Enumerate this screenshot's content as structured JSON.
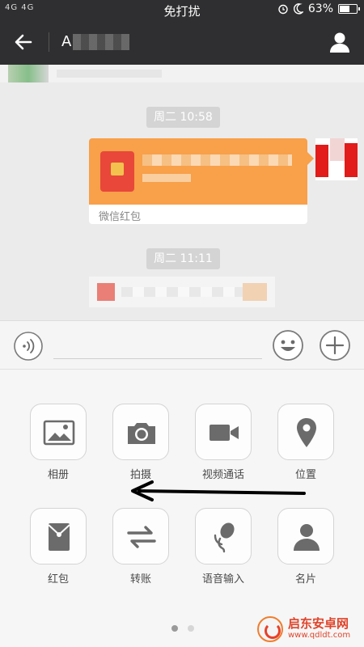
{
  "status_bar": {
    "signal_text": "4G 4G",
    "mode_text": "免打扰",
    "battery_text": "63%",
    "battery_level": 0.63
  },
  "header": {
    "contact_name_visible": "A",
    "back_icon": "arrow-left-icon",
    "profile_icon": "person-icon"
  },
  "chat": {
    "messages": [
      {
        "time": "周二 10:58",
        "type": "red-packet",
        "label": "微信红包"
      },
      {
        "time": "周二 11:11",
        "type": "text"
      }
    ]
  },
  "input_bar": {
    "voice_icon": "voice-icon",
    "emoji_icon": "emoji-icon",
    "plus_icon": "plus-icon"
  },
  "panel": {
    "items": [
      {
        "label": "相册",
        "icon": "image-icon"
      },
      {
        "label": "拍摄",
        "icon": "camera-icon"
      },
      {
        "label": "视频通话",
        "icon": "video-icon"
      },
      {
        "label": "位置",
        "icon": "location-icon"
      },
      {
        "label": "红包",
        "icon": "red-packet-icon"
      },
      {
        "label": "转账",
        "icon": "transfer-icon"
      },
      {
        "label": "语音输入",
        "icon": "microphone-icon"
      },
      {
        "label": "名片",
        "icon": "contact-card-icon"
      }
    ],
    "page_count": 2,
    "current_page": 1
  },
  "watermark": {
    "title": "启东安卓网",
    "url": "www.qdldt.com"
  },
  "colors": {
    "titlebar": "#2f2f31",
    "red_packet": "#f8a04a",
    "icon_gray": "#6b6b6b"
  }
}
